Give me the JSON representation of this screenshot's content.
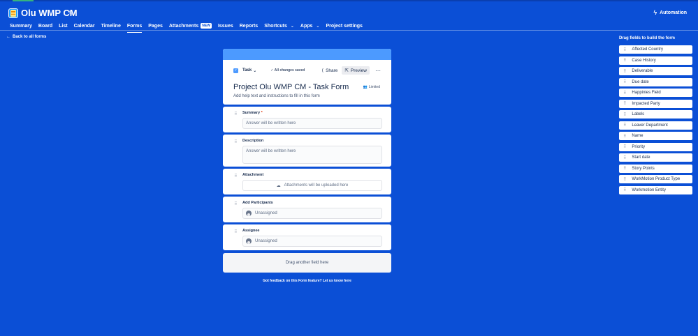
{
  "header": {
    "project_title": "Olu WMP CM",
    "automation_label": "Automation",
    "nav": [
      {
        "label": "Summary"
      },
      {
        "label": "Board"
      },
      {
        "label": "List"
      },
      {
        "label": "Calendar"
      },
      {
        "label": "Timeline"
      },
      {
        "label": "Forms",
        "active": true
      },
      {
        "label": "Pages"
      },
      {
        "label": "Attachments",
        "badge": "NEW"
      },
      {
        "label": "Issues"
      },
      {
        "label": "Reports"
      },
      {
        "label": "Shortcuts",
        "dropdown": true
      },
      {
        "label": "Apps",
        "dropdown": true
      },
      {
        "label": "Project settings"
      }
    ]
  },
  "back_link": "Back to all forms",
  "form": {
    "issue_type": "Task",
    "saved_status": "All changes saved",
    "share_label": "Share",
    "preview_label": "Preview",
    "title": "Project Olu WMP CM - Task Form",
    "access_label": "Limited",
    "help_text": "Add help text and instructions to fill in this form",
    "fields": {
      "summary": {
        "label": "Summary",
        "required_mark": "*",
        "placeholder": "Answer will be written here"
      },
      "description": {
        "label": "Description",
        "placeholder": "Answer will be written here"
      },
      "attachment": {
        "label": "Attachment",
        "placeholder": "Attachments will be uploaded here"
      },
      "participants": {
        "label": "Add Participants",
        "value": "Unassigned"
      },
      "assignee": {
        "label": "Assignee",
        "value": "Unassigned"
      }
    },
    "drop_zone": "Drag another field here",
    "feedback": "Got feedback on this Form feature? Let us know here"
  },
  "panel": {
    "title": "Drag fields to build the form",
    "items": [
      "Affected Country",
      "Case History",
      "Deliverable",
      "Due date",
      "Happinies Field",
      "Impacted Party",
      "Labels",
      "Leaver Department",
      "Name",
      "Priority",
      "Start date",
      "Story Points",
      "WorkMotion Product Type",
      "Workmotion Entity"
    ]
  }
}
